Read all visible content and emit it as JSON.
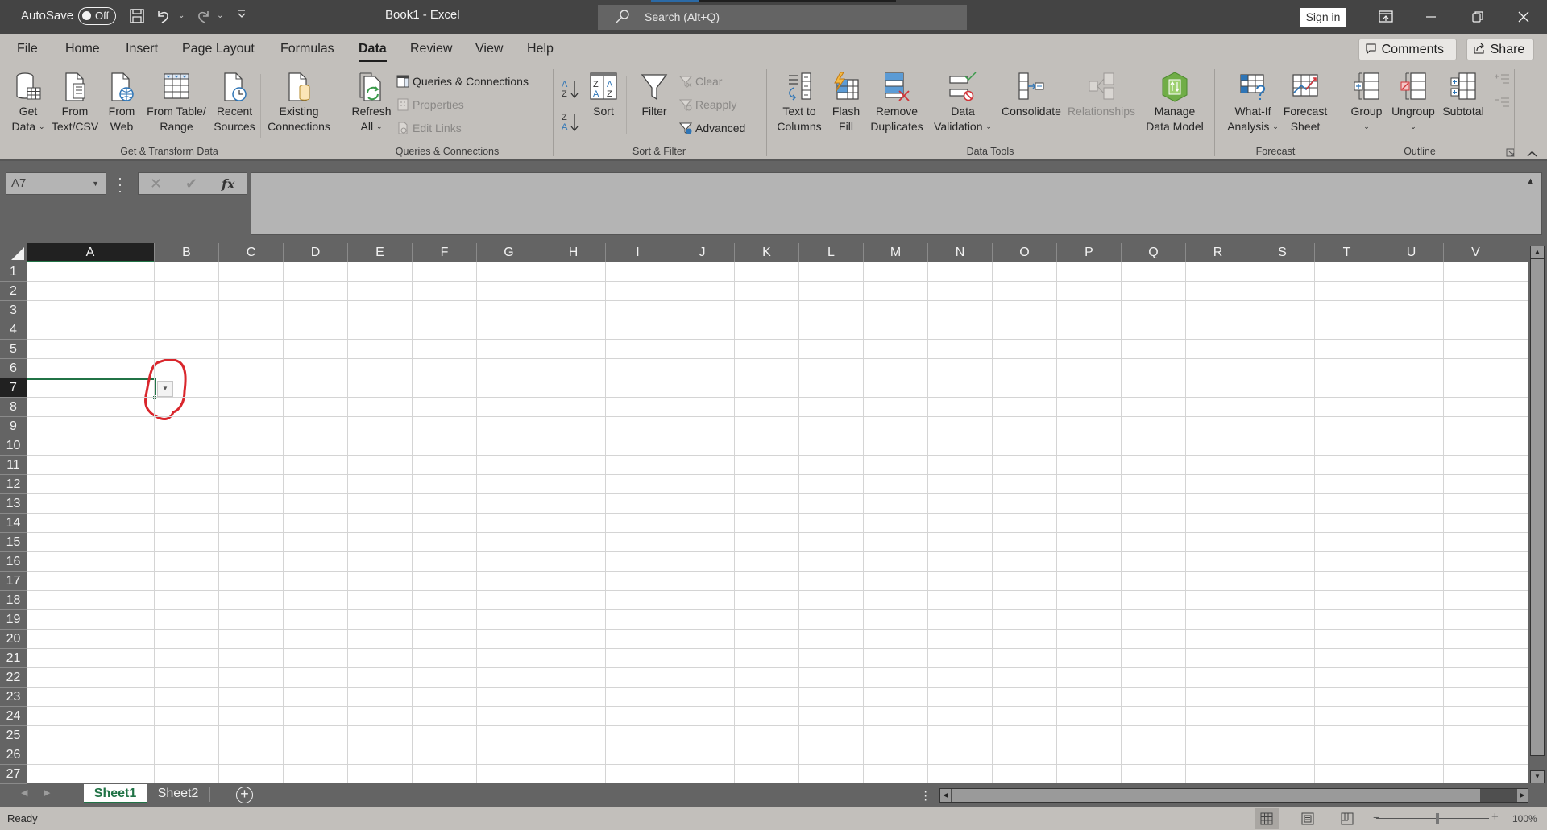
{
  "titlebar": {
    "autosave_label": "AutoSave",
    "autosave_state": "Off",
    "doc_title": "Book1  -  Excel",
    "search_placeholder": "Search (Alt+Q)",
    "signin_label": "Sign in"
  },
  "menu": {
    "tabs": [
      {
        "label": "File"
      },
      {
        "label": "Home"
      },
      {
        "label": "Insert"
      },
      {
        "label": "Page Layout"
      },
      {
        "label": "Formulas"
      },
      {
        "label": "Data",
        "active": true
      },
      {
        "label": "Review"
      },
      {
        "label": "View"
      },
      {
        "label": "Help"
      }
    ],
    "comments_label": "Comments",
    "share_label": "Share"
  },
  "ribbon": {
    "groups": {
      "get_transform": "Get & Transform Data",
      "queries": "Queries & Connections",
      "sort_filter": "Sort & Filter",
      "data_tools": "Data Tools",
      "forecast": "Forecast",
      "outline": "Outline"
    },
    "buttons": {
      "get_data": [
        "Get",
        "Data"
      ],
      "from_text": [
        "From",
        "Text/CSV"
      ],
      "from_web": [
        "From",
        "Web"
      ],
      "from_table": [
        "From Table/",
        "Range"
      ],
      "recent_sources": [
        "Recent",
        "Sources"
      ],
      "existing_connections": [
        "Existing",
        "Connections"
      ],
      "refresh_all": [
        "Refresh",
        "All"
      ],
      "queries_connections": "Queries & Connections",
      "properties": "Properties",
      "edit_links": "Edit Links",
      "sort": "Sort",
      "filter": "Filter",
      "clear": "Clear",
      "reapply": "Reapply",
      "advanced": "Advanced",
      "text_to_columns": [
        "Text to",
        "Columns"
      ],
      "flash_fill": [
        "Flash",
        "Fill"
      ],
      "remove_duplicates": [
        "Remove",
        "Duplicates"
      ],
      "data_validation": [
        "Data",
        "Validation"
      ],
      "consolidate": "Consolidate",
      "relationships": "Relationships",
      "manage_data_model": [
        "Manage",
        "Data Model"
      ],
      "what_if": [
        "What-If",
        "Analysis"
      ],
      "forecast_sheet": [
        "Forecast",
        "Sheet"
      ],
      "group": "Group",
      "ungroup": "Ungroup",
      "subtotal": "Subtotal"
    }
  },
  "formula_bar": {
    "name_box": "A7",
    "formula": ""
  },
  "grid": {
    "columns": [
      "A",
      "B",
      "C",
      "D",
      "E",
      "F",
      "G",
      "H",
      "I",
      "J",
      "K",
      "L",
      "M",
      "N",
      "O",
      "P",
      "Q",
      "R",
      "S",
      "T",
      "U",
      "V"
    ],
    "rows": [
      "1",
      "2",
      "3",
      "4",
      "5",
      "6",
      "7",
      "8",
      "9",
      "10",
      "11",
      "12",
      "13",
      "14",
      "15",
      "16",
      "17",
      "18",
      "19",
      "20",
      "21",
      "22",
      "23",
      "24",
      "25",
      "26",
      "27"
    ],
    "selected_cell": "A7",
    "selected_column": "A",
    "selected_row": "7",
    "annotation": "red-circle-around-dropdown"
  },
  "sheets": {
    "tabs": [
      {
        "label": "Sheet1",
        "active": true
      },
      {
        "label": "Sheet2"
      }
    ]
  },
  "status": {
    "text": "Ready",
    "zoom": "100%"
  },
  "colors": {
    "accent": "#217346",
    "annotation": "#d9262c"
  }
}
